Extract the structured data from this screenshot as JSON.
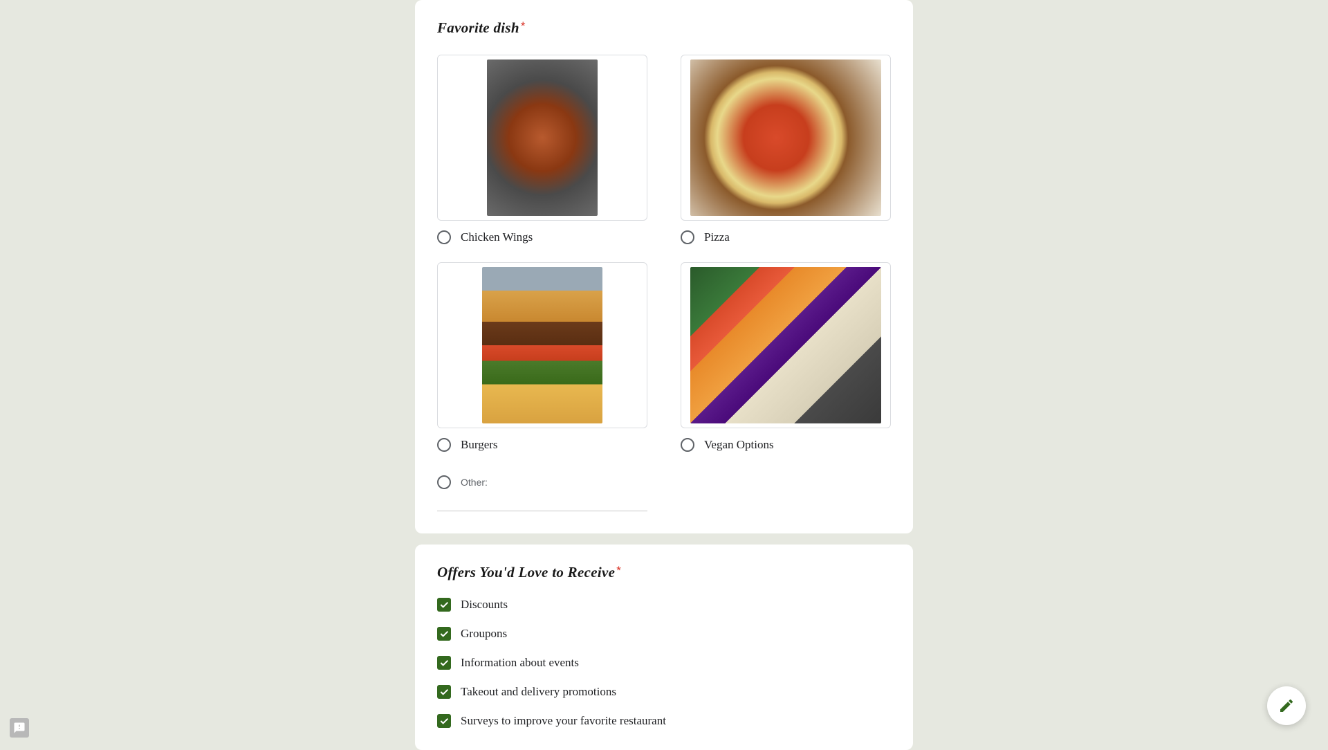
{
  "q1": {
    "title": "Favorite dish",
    "required_mark": "*",
    "options": [
      {
        "label": "Chicken Wings",
        "img_class": "wings"
      },
      {
        "label": "Pizza",
        "img_class": "pizza"
      },
      {
        "label": "Burgers",
        "img_class": "burger"
      },
      {
        "label": "Vegan Options",
        "img_class": "vegan"
      }
    ],
    "other_label": "Other:"
  },
  "q2": {
    "title": "Offers You'd Love to Receive",
    "required_mark": "*",
    "options": [
      {
        "label": "Discounts",
        "checked": true
      },
      {
        "label": "Groupons",
        "checked": true
      },
      {
        "label": "Information about events",
        "checked": true
      },
      {
        "label": "Takeout and delivery promotions",
        "checked": true
      },
      {
        "label": "Surveys to improve your favorite restaurant",
        "checked": true
      }
    ]
  },
  "colors": {
    "accent": "#33691e",
    "required": "#d93025",
    "background": "#e6e8e0"
  }
}
